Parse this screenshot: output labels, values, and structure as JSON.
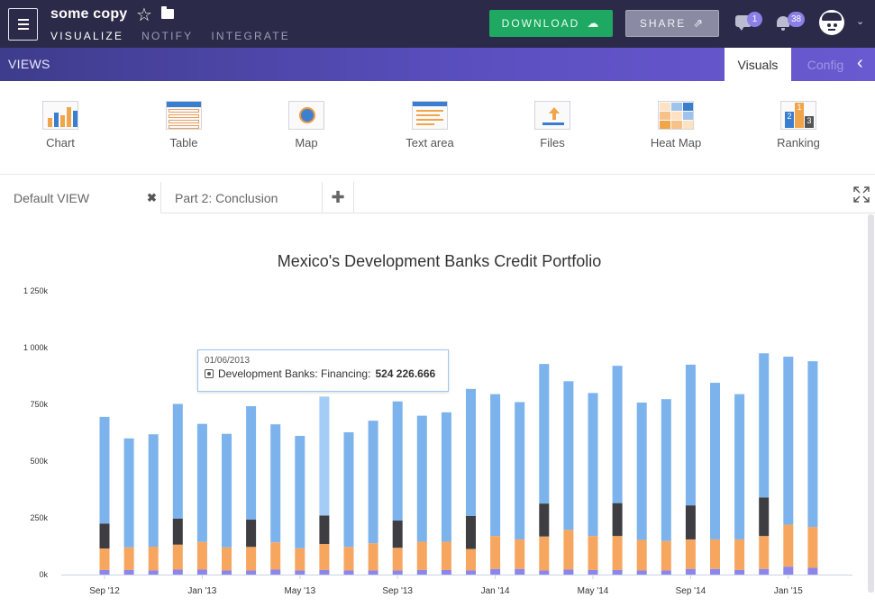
{
  "app": {
    "title": "some copy",
    "nav": [
      "VISUALIZE",
      "NOTIFY",
      "INTEGRATE"
    ],
    "download_label": "DOWNLOAD",
    "share_label": "SHARE",
    "messages_count": "1",
    "notifications_count": "38"
  },
  "views": {
    "label": "VIEWS",
    "tabs": [
      "Visuals",
      "Config"
    ]
  },
  "palette": [
    {
      "label": "Chart",
      "icon": "bar-chart-icon"
    },
    {
      "label": "Table",
      "icon": "table-icon"
    },
    {
      "label": "Map",
      "icon": "globe-map-icon"
    },
    {
      "label": "Text area",
      "icon": "text-area-icon"
    },
    {
      "label": "Files",
      "icon": "upload-file-icon"
    },
    {
      "label": "Heat Map",
      "icon": "heat-map-icon"
    },
    {
      "label": "Ranking",
      "icon": "ranking-icon"
    }
  ],
  "doc_tabs": [
    "Default VIEW",
    "Part 2: Conclusion"
  ],
  "colors": {
    "blue": "#7cb3ec",
    "blue_highlight": "#a3cdf6",
    "dark": "#3e3e42",
    "orange": "#f7a660",
    "purple": "#8c85ec",
    "accent_green": "#1ea862",
    "topbar": "#2b2a48"
  },
  "tooltip": {
    "date": "01/06/2013",
    "label": "Development Banks: Financing:",
    "value": "524 226.666"
  },
  "chart_data": {
    "type": "bar",
    "stacked": true,
    "title": "Mexico's Development Banks Credit Portfolio",
    "ylim": [
      0,
      1250000
    ],
    "y_ticks": [
      {
        "value": 0,
        "label": "0k"
      },
      {
        "value": 250000,
        "label": "250k"
      },
      {
        "value": 500000,
        "label": "500k"
      },
      {
        "value": 750000,
        "label": "750k"
      },
      {
        "value": 1000000,
        "label": "1 000k"
      },
      {
        "value": 1250000,
        "label": "1 250k"
      }
    ],
    "x_labels": [
      {
        "index": 0,
        "label": "Sep '12"
      },
      {
        "index": 4,
        "label": "Jan '13"
      },
      {
        "index": 8,
        "label": "May '13"
      },
      {
        "index": 12,
        "label": "Sep '13"
      },
      {
        "index": 16,
        "label": "Jan '14"
      },
      {
        "index": 20,
        "label": "May '14"
      },
      {
        "index": 24,
        "label": "Sep '14"
      },
      {
        "index": 28,
        "label": "Jan '15"
      }
    ],
    "highlight_index": 9,
    "series": [
      {
        "color": "purple",
        "values": [
          20000,
          20000,
          18000,
          22000,
          22000,
          18000,
          18000,
          22000,
          18000,
          20000,
          18000,
          18000,
          18000,
          20000,
          20000,
          18000,
          25000,
          25000,
          18000,
          22000,
          20000,
          20000,
          18000,
          18000,
          25000,
          25000,
          20000,
          25000,
          35000,
          30000
        ]
      },
      {
        "color": "orange",
        "values": [
          95000,
          100000,
          105000,
          110000,
          122000,
          102000,
          104000,
          120000,
          98000,
          115000,
          104000,
          120000,
          100000,
          125000,
          125000,
          95000,
          145000,
          130000,
          150000,
          175000,
          150000,
          150000,
          135000,
          130000,
          130000,
          130000,
          135000,
          145000,
          185000,
          180000
        ]
      },
      {
        "color": "dark",
        "values": [
          110000,
          0,
          0,
          115000,
          0,
          0,
          120000,
          0,
          0,
          125000,
          0,
          0,
          120000,
          0,
          0,
          145000,
          0,
          0,
          145000,
          0,
          0,
          145000,
          0,
          0,
          150000,
          0,
          0,
          170000,
          0,
          0
        ]
      },
      {
        "color": "blue",
        "values": [
          470000,
          480000,
          495000,
          505000,
          520000,
          500000,
          500000,
          520000,
          495000,
          524226.666,
          505000,
          540000,
          525000,
          555000,
          570000,
          560000,
          625000,
          605000,
          615000,
          655000,
          630000,
          605000,
          605000,
          625000,
          620000,
          690000,
          640000,
          635000,
          740000,
          730000
        ]
      }
    ]
  }
}
